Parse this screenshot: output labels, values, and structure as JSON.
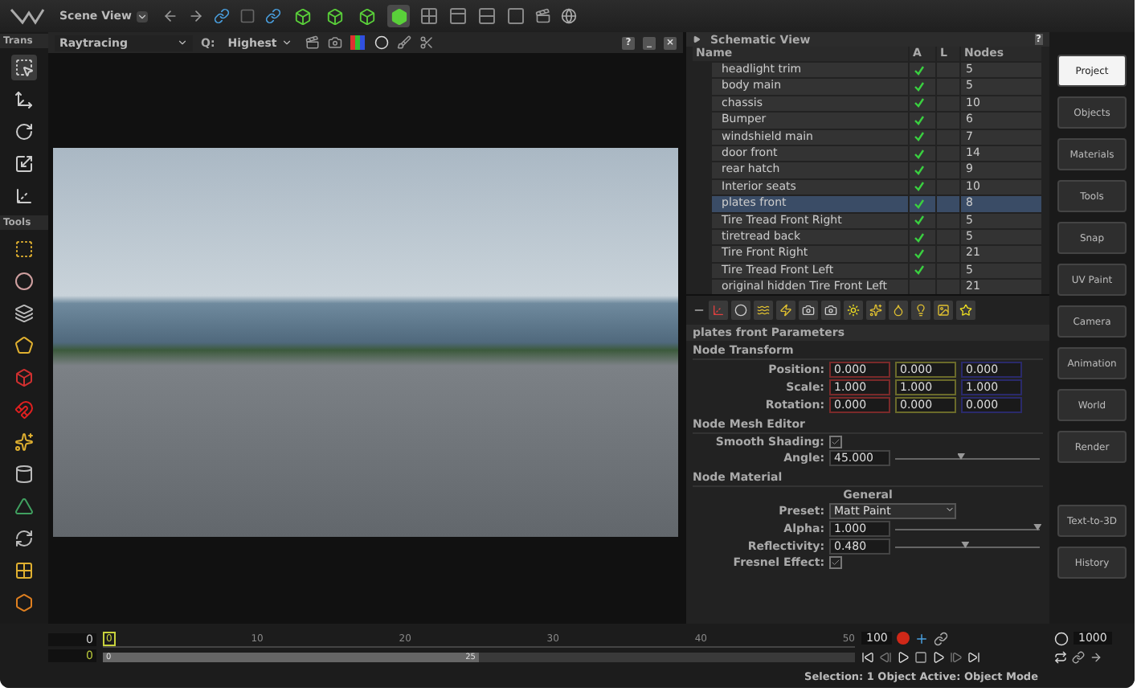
{
  "top_bar": {
    "view_menu": "Scene View",
    "shading_modes": [
      {
        "selected": false
      },
      {
        "selected": false
      },
      {
        "selected": false
      },
      {
        "selected": true
      }
    ]
  },
  "left_toolbar": {
    "transform_label": "Trans",
    "transform_tools": [
      {
        "selected": true
      },
      {
        "selected": false
      },
      {
        "selected": false
      },
      {
        "selected": false
      },
      {
        "selected": false
      }
    ],
    "tools_label": "Tools"
  },
  "viewport": {
    "render_mode": "Raytracing",
    "quality_label": "Q:",
    "quality": "Highest",
    "window_buttons": [
      "?",
      "_",
      "×"
    ]
  },
  "schematic": {
    "title": "Schematic View",
    "help": "?",
    "columns": [
      "Name",
      "A",
      "L",
      "Nodes"
    ],
    "rows": [
      {
        "name": "headlight trim",
        "active": true,
        "nodes": "5",
        "selected": false
      },
      {
        "name": "body main",
        "active": true,
        "nodes": "5",
        "selected": false
      },
      {
        "name": "chassis",
        "active": true,
        "nodes": "10",
        "selected": false
      },
      {
        "name": "Bumper",
        "active": true,
        "nodes": "6",
        "selected": false
      },
      {
        "name": "windshield main",
        "active": true,
        "nodes": "7",
        "selected": false
      },
      {
        "name": "door front",
        "active": true,
        "nodes": "14",
        "selected": false
      },
      {
        "name": "rear hatch",
        "active": true,
        "nodes": "9",
        "selected": false
      },
      {
        "name": "Interior seats",
        "active": true,
        "nodes": "10",
        "selected": false
      },
      {
        "name": "plates front",
        "active": true,
        "nodes": "8",
        "selected": true
      },
      {
        "name": "Tire Tread Front Right",
        "active": true,
        "nodes": "5",
        "selected": false
      },
      {
        "name": "tiretread back",
        "active": true,
        "nodes": "5",
        "selected": false
      },
      {
        "name": "Tire Front Right",
        "active": true,
        "nodes": "21",
        "selected": false
      },
      {
        "name": "Tire Tread Front Left",
        "active": true,
        "nodes": "5",
        "selected": false
      },
      {
        "name": "original hidden Tire Front Left",
        "active": false,
        "nodes": "21",
        "selected": false
      }
    ]
  },
  "parameters": {
    "title": "plates front Parameters",
    "transform": {
      "heading": "Node Transform",
      "rows": [
        {
          "label": "Position:",
          "values": [
            "0.000",
            "0.000",
            "0.000"
          ]
        },
        {
          "label": "Scale:",
          "values": [
            "1.000",
            "1.000",
            "1.000"
          ]
        },
        {
          "label": "Rotation:",
          "values": [
            "0.000",
            "0.000",
            "0.000"
          ]
        }
      ]
    },
    "mesh": {
      "heading": "Node Mesh Editor",
      "fields": [
        {
          "kind": "checkbox",
          "label": "Smooth Shading:",
          "checked": true
        },
        {
          "kind": "slider",
          "label": "Angle:",
          "value": "45.000",
          "level": 0.45
        }
      ]
    },
    "material": {
      "heading": "Node Material",
      "group": "General",
      "fields": [
        {
          "kind": "dropdown",
          "label": "Preset:",
          "value": "Matt Paint"
        },
        {
          "kind": "slider",
          "label": "Alpha:",
          "value": "1.000",
          "level": 0.98
        },
        {
          "kind": "slider",
          "label": "Reflectivity:",
          "value": "0.480",
          "level": 0.48
        },
        {
          "kind": "checkbox",
          "label": "Fresnel Effect:",
          "checked": true
        }
      ]
    }
  },
  "panel_buttons": [
    {
      "label": "Project",
      "selected": true
    },
    {
      "label": "Objects",
      "selected": false
    },
    {
      "label": "Materials",
      "selected": false
    },
    {
      "label": "Tools",
      "selected": false
    },
    {
      "label": "Snap",
      "selected": false
    },
    {
      "label": "UV Paint",
      "selected": false
    },
    {
      "label": "Camera",
      "selected": false
    },
    {
      "label": "Animation",
      "selected": false
    },
    {
      "label": "World",
      "selected": false
    },
    {
      "label": "Render",
      "selected": false
    }
  ],
  "extra_buttons": [
    {
      "label": "Text-to-3D",
      "selected": false
    },
    {
      "label": "History",
      "selected": false
    }
  ],
  "timeline": {
    "start": "0",
    "current": "0",
    "marker": "0",
    "ticks": [
      "10",
      "20",
      "30",
      "40",
      "50"
    ],
    "range_start": "0",
    "range_end": "25",
    "level": 0.5,
    "end_frame": "100",
    "frames": "1000"
  },
  "status": "Selection: 1 Object  Active: Object Mode"
}
